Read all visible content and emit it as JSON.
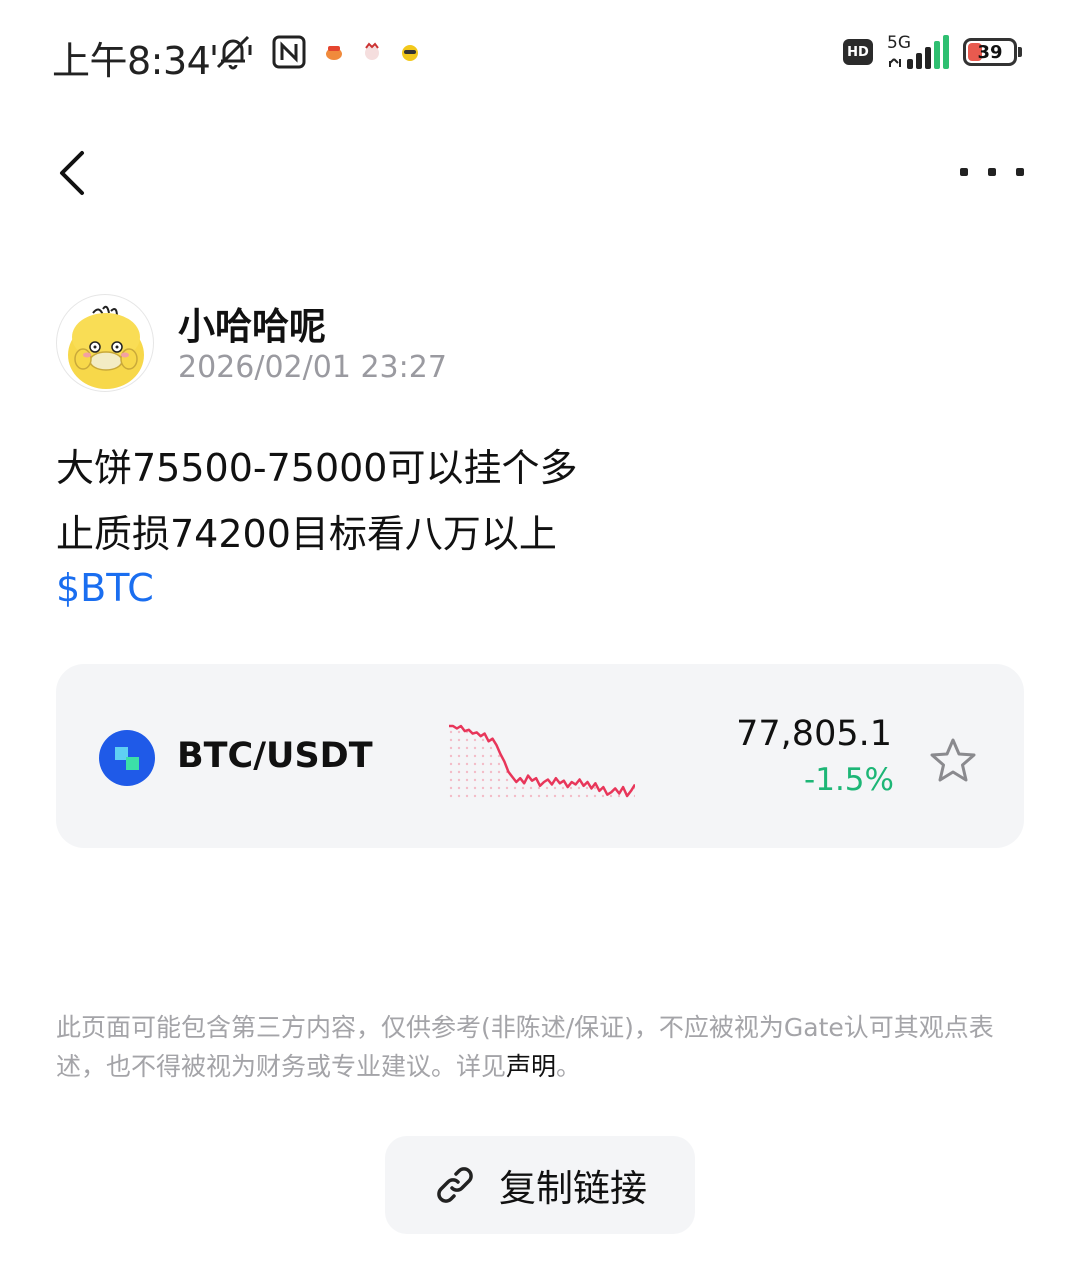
{
  "status_bar": {
    "time": "上午8:34",
    "hd": "HD",
    "network": "5G",
    "battery": "39"
  },
  "nav": {
    "back_icon": "chevron-left-icon",
    "more_icon": "more-horizontal-icon"
  },
  "post": {
    "author_name": "小哈哈呢",
    "timestamp": "2026/02/01 23:27",
    "lines": [
      "大饼75500-75000可以挂个多",
      "止质损74200目标看八万以上"
    ],
    "tag": "$BTC"
  },
  "ticker": {
    "pair": "BTC/USDT",
    "price": "77,805.1",
    "change": "-1.5%",
    "change_color": "#1db676",
    "sparkline_color": "#e8365a",
    "coin_color": "#1f5ae8",
    "sparkline_points": [
      99,
      99,
      98.8,
      99,
      98.6,
      98.7,
      98.4,
      98.5,
      98.2,
      98.4,
      97.8,
      98,
      97.5,
      96.8,
      96.2,
      95.4,
      95,
      94.6,
      94.9,
      94.5,
      95.1,
      94.7,
      94.9,
      94.3,
      94.6,
      94.8,
      94.4,
      94.9,
      94.5,
      94.7,
      94.2,
      94.6,
      94.4,
      94.8,
      94.3,
      94.6,
      94.1,
      94.5,
      93.9,
      94.2,
      93.6,
      93.8,
      94.1,
      93.7,
      94.2,
      93.5,
      93.9,
      94.4
    ]
  },
  "disclaimer": {
    "text": "此页面可能包含第三方内容，仅供参考(非陈述/保证)，不应被视为Gate认可其观点表述，也不得被视为财务或专业建议。详见",
    "link": "声明",
    "end": "。"
  },
  "copy_link": {
    "label": "复制链接",
    "icon": "link-icon"
  }
}
